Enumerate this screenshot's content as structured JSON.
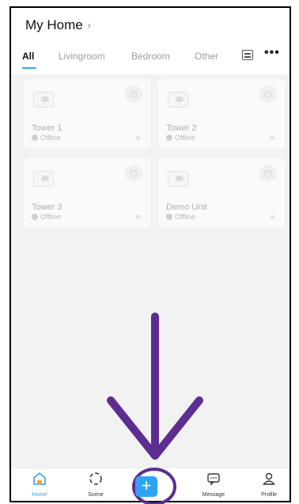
{
  "header": {
    "title": "My Home",
    "title_chevron_icon": "chevron-right-icon"
  },
  "tabs": [
    {
      "label": "All",
      "active": true
    },
    {
      "label": "Livingroom",
      "active": false
    },
    {
      "label": "Bedroom",
      "active": false
    },
    {
      "label": "Other",
      "active": false
    }
  ],
  "tab_actions": {
    "list_icon": "list-icon",
    "more_icon": "more-icon",
    "more_glyph": "•••"
  },
  "devices": [
    {
      "name": "Tower 1",
      "status": "Offline"
    },
    {
      "name": "Tower 2",
      "status": "Offline"
    },
    {
      "name": "Tower 3",
      "status": "Offline"
    },
    {
      "name": "Demo Unit",
      "status": "Offline"
    }
  ],
  "bottom_nav": {
    "home": {
      "label": "Home",
      "icon": "home-icon"
    },
    "scene": {
      "label": "Scene",
      "icon": "scene-icon"
    },
    "add": {
      "icon": "plus-icon",
      "glyph": "+"
    },
    "message": {
      "label": "Message",
      "icon": "message-icon"
    },
    "profile": {
      "label": "Profile",
      "icon": "profile-icon"
    }
  },
  "colors": {
    "accent": "#2ea3f2",
    "annotation": "#5e2d91"
  }
}
